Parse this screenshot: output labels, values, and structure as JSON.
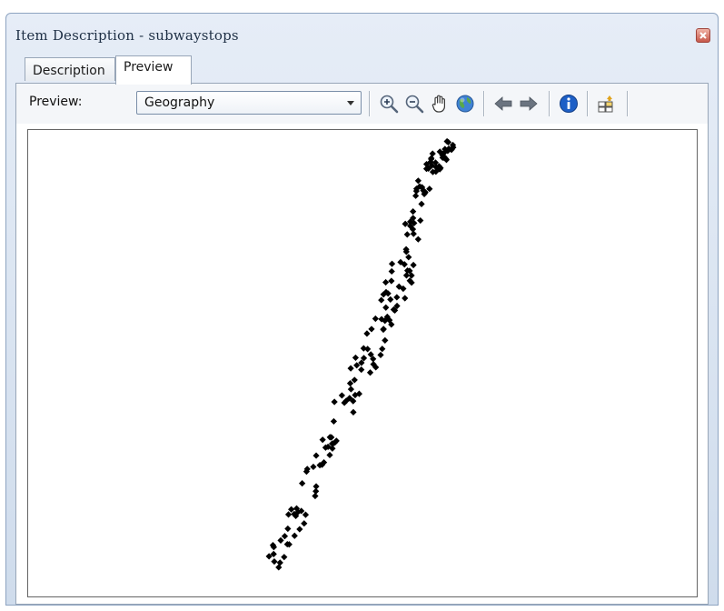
{
  "window": {
    "title": "Item Description - subwaystops",
    "tabs": [
      {
        "label": "Description",
        "active": false
      },
      {
        "label": "Preview",
        "active": true
      }
    ]
  },
  "toolbar": {
    "preview_label": "Preview:",
    "preview_mode": "Geography",
    "tools": [
      "zoom-in-icon",
      "zoom-out-icon",
      "pan-hand-icon",
      "full-extent-globe-icon",
      "back-arrow-icon",
      "forward-arrow-icon",
      "identify-info-icon",
      "create-thumbnail-icon"
    ]
  },
  "map": {
    "symbol": "black-diamond-point",
    "point_color": "#000000",
    "point_count_approx": 170
  },
  "colors": {
    "title_text": "#1e2f45",
    "window_frame": "#cfdcec",
    "identify_blue": "#1d5fc6",
    "close_red": "#c7584a"
  }
}
